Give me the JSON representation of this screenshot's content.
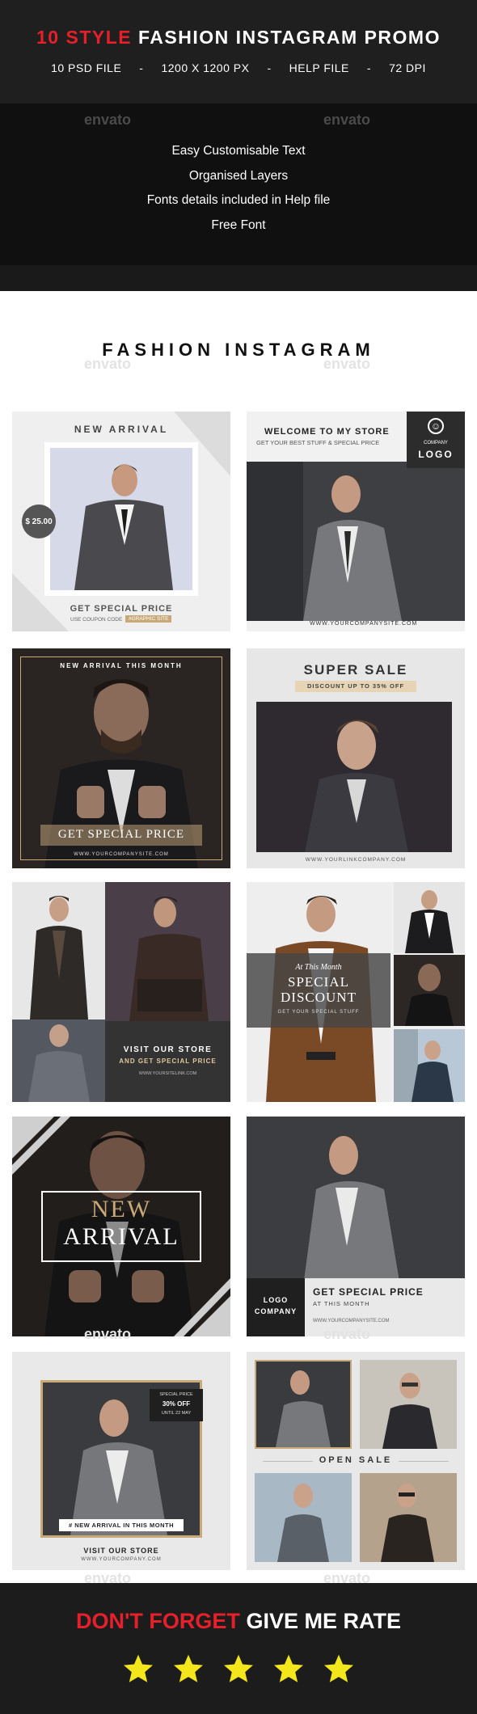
{
  "header": {
    "title_accent": "10 STYLE",
    "title_rest": "FASHION INSTAGRAM PROMO",
    "specs": [
      "10 PSD FILE",
      "-",
      "1200 X 1200 PX",
      "-",
      "HELP FILE",
      "-",
      "72 DPI"
    ]
  },
  "watermark": "envato",
  "features": [
    "Easy Customisable Text",
    "Organised Layers",
    "Fonts details included in Help file",
    "Free Font"
  ],
  "section_title": "FASHION INSTAGRAM",
  "cards": {
    "c1": {
      "title": "NEW ARRIVAL",
      "price": "$ 25.00",
      "cta": "GET SPECIAL PRICE",
      "coupon": "USE COUPON CODE",
      "code": "#GRAPHIC SITE"
    },
    "c2": {
      "title": "WELCOME TO MY STORE",
      "subtitle": "GET YOUR BEST STUFF & SPECIAL PRICE",
      "logo_top": "COMPANY",
      "logo": "LOGO",
      "url": "WWW.YOURCOMPANYSITE.COM"
    },
    "c3": {
      "title": "NEW ARRIVAL THIS MONTH",
      "cta": "GET SPECIAL PRICE",
      "url": "WWW.YOURCOMPANYSITE.COM"
    },
    "c4": {
      "title": "SUPER SALE",
      "subtitle": "DISCOUNT UP TO 35% OFF",
      "url": "WWW.YOURLINKCOMPANY.COM"
    },
    "c5": {
      "line1": "VISIT OUR STORE",
      "line2": "AND GET SPECIAL PRICE",
      "url": "WWW.YOURSITELINK.COM"
    },
    "c6": {
      "line1": "At This Month",
      "line2": "SPECIAL",
      "line3": "DISCOUNT",
      "line4": "GET YOUR SPECIAL STUFF"
    },
    "c7": {
      "line1": "NEW",
      "line2": "ARRIVAL"
    },
    "c8": {
      "logo1": "LOGO",
      "logo2": "COMPANY",
      "cta": "GET SPECIAL PRICE",
      "sub": "AT THIS MONTH",
      "url": "WWW.YOURCOMPANYSITE.COM"
    },
    "c9": {
      "badge1": "SPECIAL PRICE",
      "badge2": "30% OFF",
      "badge3": "UNTIL 22 MAY",
      "tag": "# NEW ARRIVAL IN THIS MONTH",
      "visit": "VISIT OUR STORE",
      "url": "WWW.YOURCOMPANY.COM"
    },
    "c10": {
      "title": "OPEN SALE"
    }
  },
  "footer": {
    "accent": "DON'T FORGET",
    "rest": "GIVE ME RATE",
    "stars": 5
  },
  "colors": {
    "accent_red": "#e5202a",
    "star_yellow": "#f3e61a",
    "tan": "#c9a978",
    "dark": "#1f1f1f"
  }
}
